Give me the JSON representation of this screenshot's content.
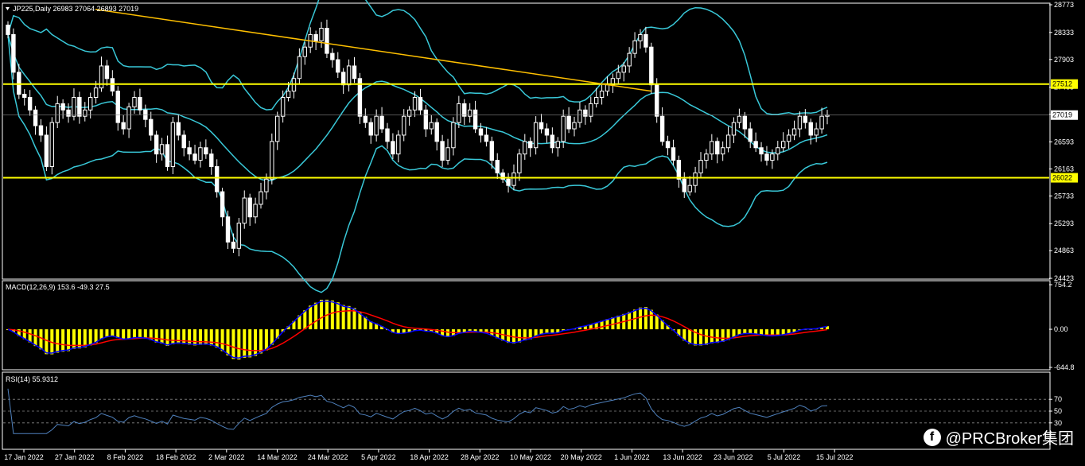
{
  "chart_data": [
    {
      "type": "candlestick",
      "title": "JP225,Daily",
      "ohlc_label": "26983 27064 26893 27019",
      "yticks": [
        "28773",
        "28333",
        "27903",
        "27463",
        "27033",
        "26593",
        "26163",
        "25733",
        "25293",
        "24863",
        "24423"
      ],
      "ylim": [
        24423,
        28773
      ],
      "hlines": [
        27512,
        26022
      ],
      "last_price": "27019",
      "hline_labels": [
        "27512",
        "26022"
      ],
      "xticks": [
        "17 Jan 2022",
        "27 Jan 2022",
        "8 Feb 2022",
        "18 Feb 2022",
        "2 Mar 2022",
        "14 Mar 2022",
        "24 Mar 2022",
        "5 Apr 2022",
        "18 Apr 2022",
        "28 Apr 2022",
        "10 May 2022",
        "20 May 2022",
        "1 Jun 2022",
        "13 Jun 2022",
        "23 Jun 2022",
        "5 Jul 2022",
        "15 Jul 2022"
      ],
      "closes": [
        28300,
        27700,
        27350,
        27300,
        27100,
        26850,
        26700,
        26200,
        26900,
        27200,
        27100,
        27000,
        27300,
        27000,
        27100,
        27300,
        27450,
        27800,
        27600,
        27400,
        26900,
        26800,
        27150,
        27300,
        27100,
        26950,
        26700,
        26400,
        26550,
        26200,
        26900,
        26700,
        26500,
        26400,
        26300,
        26500,
        26400,
        26200,
        25800,
        25400,
        25000,
        24900,
        25300,
        25700,
        25400,
        25600,
        25800,
        26000,
        26600,
        27000,
        27300,
        27400,
        27600,
        27950,
        28100,
        28300,
        28200,
        28400,
        28000,
        27900,
        27700,
        27500,
        27800,
        27600,
        27000,
        26900,
        26700,
        27000,
        26800,
        26600,
        26400,
        26700,
        27000,
        27100,
        27300,
        27100,
        26800,
        26900,
        26600,
        26300,
        26500,
        26900,
        27200,
        27000,
        27100,
        26800,
        26700,
        26600,
        26300,
        26100,
        26000,
        25900,
        26100,
        26400,
        26600,
        26500,
        26900,
        26800,
        26700,
        26500,
        26600,
        27000,
        26800,
        26900,
        27100,
        27000,
        27200,
        27300,
        27400,
        27500,
        27600,
        27700,
        27800,
        28000,
        28200,
        28300,
        28100,
        27500,
        27000,
        26600,
        26500,
        26300,
        26000,
        25800,
        25900,
        26100,
        26300,
        26400,
        26600,
        26400,
        26500,
        26700,
        26900,
        27000,
        26800,
        26600,
        26500,
        26400,
        26300,
        26400,
        26500,
        26600,
        26700,
        26800,
        27000,
        26900,
        26700,
        26800,
        27000,
        27019
      ],
      "rsi_ticks": [
        "70",
        "50",
        "30"
      ],
      "rsi_label": "RSI(14) 55.9312",
      "macd_label": "MACD(12,26,9) 153.6 -49.3 27.5",
      "macd_ticks": [
        "754.2",
        "0.00",
        "-644.8"
      ]
    }
  ],
  "watermark": {
    "text": "@PRCBroker集团",
    "icon": "facebook-icon"
  },
  "colors": {
    "bull": "#ffffff",
    "bear": "#ffffff",
    "bands": "#39c8d8",
    "hline": "#ffff00",
    "trend": "#ffc000",
    "macd": "#0000ff",
    "signal": "#ff0000",
    "hist": "#ffff00",
    "rsi": "#4f81bd"
  }
}
